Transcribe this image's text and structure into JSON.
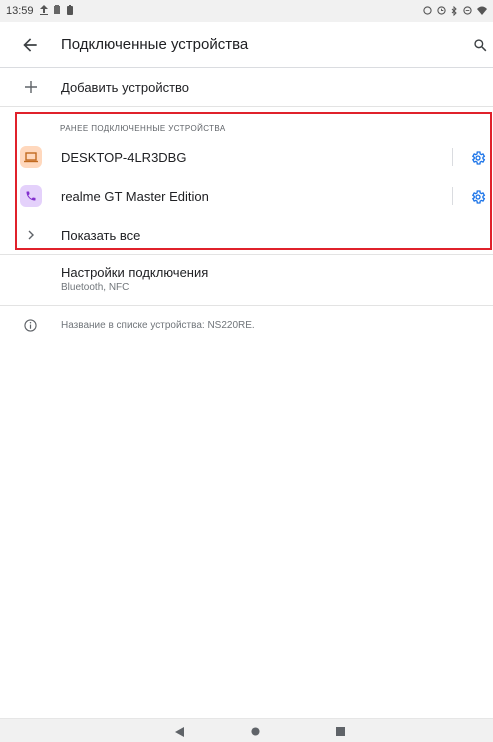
{
  "status_bar": {
    "time": "13:59"
  },
  "header": {
    "title": "Подключенные устройства"
  },
  "add_device": {
    "label": "Добавить устройство"
  },
  "previously_connected": {
    "section_title": "РАНЕЕ ПОДКЛЮЧЕННЫЕ УСТРОЙСТВА",
    "devices": [
      {
        "name": "DESKTOP-4LR3DBG",
        "icon": "laptop-icon",
        "icon_bg": "#ffd8bd",
        "icon_color": "#c26a1f"
      },
      {
        "name": "realme GT Master Edition",
        "icon": "phone-icon",
        "icon_bg": "#e4d1fb",
        "icon_color": "#8430ce"
      }
    ],
    "show_all_label": "Показать все"
  },
  "connection_settings": {
    "label": "Настройки подключения",
    "subtitle": "Bluetooth, NFC"
  },
  "info": {
    "text": "Название в списке устройства: NS220RE."
  },
  "colors": {
    "accent": "#1a73e8",
    "highlight": "#e0212b"
  }
}
